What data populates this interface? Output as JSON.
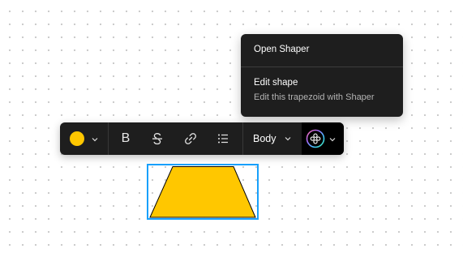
{
  "context_menu": {
    "open_label": "Open Shaper",
    "edit_title": "Edit shape",
    "edit_description": "Edit this trapezoid with Shaper"
  },
  "toolbar": {
    "fill_color": "#FFC700",
    "text_style_label": "Body",
    "buttons": [
      {
        "name": "bold",
        "icon": "bold-icon",
        "glyph": "B"
      },
      {
        "name": "strikethrough",
        "icon": "strikethrough-icon"
      },
      {
        "name": "link",
        "icon": "link-icon"
      },
      {
        "name": "bulleted-list",
        "icon": "list-icon"
      }
    ],
    "plugin_icon": "shaper-plugin-icon"
  },
  "canvas": {
    "shape_type": "trapezoid",
    "shape_fill": "#FFC700",
    "shape_stroke": "#000000",
    "selection_color": "#18A0FB"
  },
  "colors": {
    "menu_background": "#1E1E1E",
    "toolbar_background": "#1E1E1E",
    "menu_secondary_text": "#B3B3B3"
  }
}
